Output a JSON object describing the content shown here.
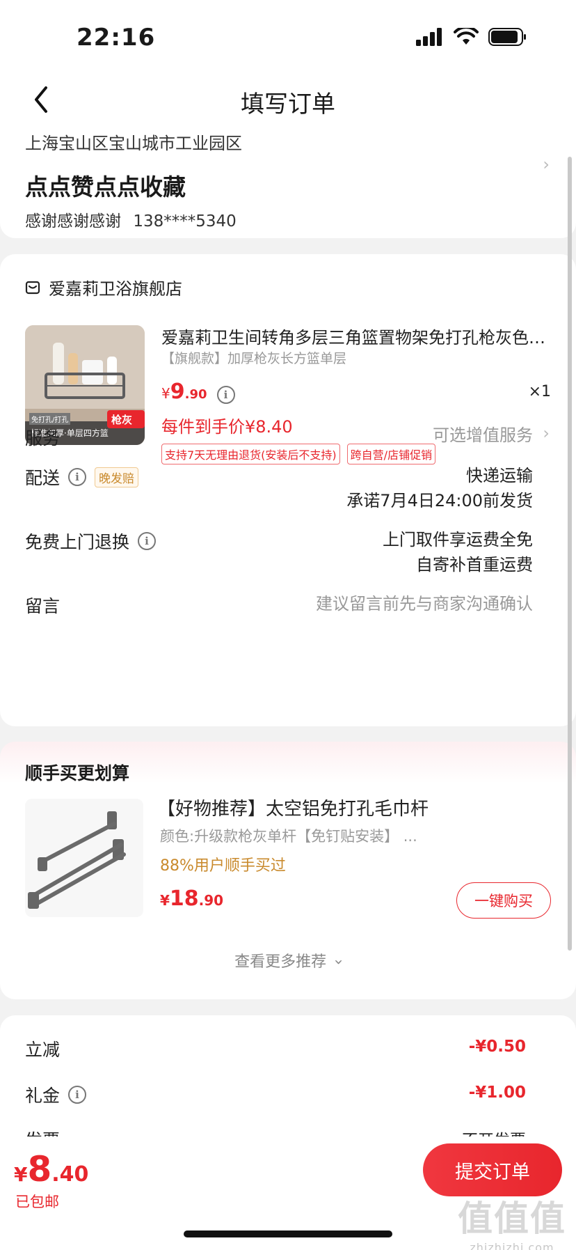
{
  "status_bar": {
    "time": "22:16"
  },
  "nav": {
    "title": "填写订单"
  },
  "address": {
    "line": "上海宝山区宝山城市工业园区",
    "name": "点点赞点点收藏",
    "contact_name": "感谢感谢感谢",
    "phone": "138****5340"
  },
  "shop": {
    "name": "爱嘉莉卫浴旗舰店"
  },
  "product": {
    "title": "爱嘉莉卫生间转角多层三角篮置物架免打孔枪灰色铝合金",
    "spec": "【旗舰款】加厚枪灰长方篮单层",
    "price_symbol": "¥",
    "price_int": "9",
    "price_dec": ".90",
    "qty": "×1",
    "unit_price_label": "每件到手价¥8.40",
    "tags": [
      "支持7天无理由退货(安装后不支持)",
      "跨自营/店铺促销"
    ],
    "image_labels": {
      "badge1": "免打孔/打孔",
      "badge2": "标准加厚·单层四方篮",
      "color": "枪灰"
    }
  },
  "service": {
    "label": "服务",
    "value": "可选增值服务"
  },
  "delivery": {
    "label": "配送",
    "badge": "晚发赔",
    "value1": "快递运输",
    "value2": "承诺7月4日24:00前发货"
  },
  "return": {
    "label": "免费上门退换",
    "value1": "上门取件享运费全免",
    "value2": "自寄补首重运费"
  },
  "message": {
    "label": "留言",
    "placeholder": "建议留言前先与商家沟通确认"
  },
  "recommend": {
    "heading": "顺手买更划算",
    "title": "【好物推荐】太空铝免打孔毛巾杆",
    "spec": "颜色:升级款枪灰单杆【免钉贴安装】 ...",
    "pct": "88%用户顺手买过",
    "price_symbol": "¥",
    "price_int": "18",
    "price_dec": ".90",
    "buy_label": "一键购买",
    "more_label": "查看更多推荐"
  },
  "summary": {
    "discount_label": "立减",
    "discount_value": "-¥0.50",
    "gift_label": "礼金",
    "gift_value": "-¥1.00",
    "invoice_label": "发票",
    "invoice_value": "不开发票"
  },
  "bottom": {
    "price_symbol": "¥",
    "price_int": "8",
    "price_dec": ".40",
    "shipping": "已包邮",
    "submit_label": "提交订单"
  },
  "watermark": {
    "big": "值值值",
    "small": "zhizhizhi.com"
  },
  "colors": {
    "accent": "#e8262d",
    "badge_orange": "#c98a2d"
  }
}
